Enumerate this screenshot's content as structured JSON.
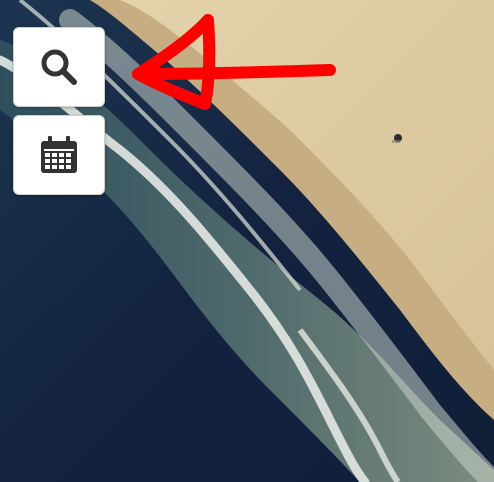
{
  "map": {
    "view": "satellite",
    "colors": {
      "ocean_deep": "#13233f",
      "ocean_mid": "#1f3a52",
      "surf": "#d6ddd3",
      "wet_sand": "#c2a77c",
      "dry_sand": "#ddc9a0"
    }
  },
  "controls": [
    {
      "icon": "search-icon",
      "interactable": true
    },
    {
      "icon": "calendar-icon",
      "interactable": true
    }
  ],
  "annotation": {
    "shape": "arrow",
    "color": "#ff0000"
  }
}
